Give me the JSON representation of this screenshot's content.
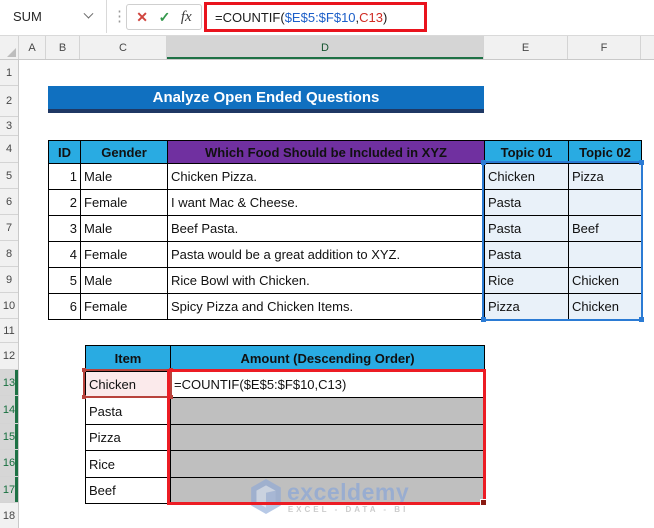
{
  "formula_bar": {
    "name_box_value": "SUM",
    "cancel_icon": "✕",
    "enter_icon": "✓",
    "fx_label": "fx",
    "formula_prefix": "=COUNTIF(",
    "formula_range": "$E$5:$F$10",
    "formula_sep": ",",
    "formula_ref": "C13",
    "formula_close": ")"
  },
  "grid": {
    "column_letters": [
      "A",
      "B",
      "C",
      "D",
      "E",
      "F"
    ],
    "selected_column": "D",
    "row_numbers": [
      "1",
      "2",
      "3",
      "4",
      "5",
      "6",
      "7",
      "8",
      "9",
      "10",
      "11",
      "12",
      "13",
      "14",
      "15",
      "16",
      "17",
      "18"
    ],
    "selected_rows": [
      13,
      14,
      15,
      16,
      17
    ]
  },
  "title_banner": {
    "text": "Analyze Open Ended Questions"
  },
  "survey_table": {
    "headers": {
      "id": "ID",
      "gender": "Gender",
      "question": "Which Food Should be Included in XYZ",
      "topic1": "Topic 01",
      "topic2": "Topic 02"
    },
    "rows": [
      {
        "id": "1",
        "gender": "Male",
        "question": "Chicken Pizza.",
        "topic1": "Chicken",
        "topic2": "Pizza"
      },
      {
        "id": "2",
        "gender": "Female",
        "question": "I want Mac & Cheese.",
        "topic1": "Pasta",
        "topic2": ""
      },
      {
        "id": "3",
        "gender": "Male",
        "question": "Beef Pasta.",
        "topic1": "Pasta",
        "topic2": "Beef"
      },
      {
        "id": "4",
        "gender": "Female",
        "question": "Pasta would be a great addition to XYZ.",
        "topic1": "Pasta",
        "topic2": ""
      },
      {
        "id": "5",
        "gender": "Male",
        "question": "Rice Bowl with Chicken.",
        "topic1": "Rice",
        "topic2": "Chicken"
      },
      {
        "id": "6",
        "gender": "Female",
        "question": "Spicy Pizza and Chicken Items.",
        "topic1": "Pizza",
        "topic2": "Chicken"
      }
    ]
  },
  "result_table": {
    "headers": {
      "item": "Item",
      "amount": "Amount (Descending Order)"
    },
    "items": [
      "Chicken",
      "Pasta",
      "Pizza",
      "Rice",
      "Beef"
    ],
    "formula_cell": "=COUNTIF($E$5:$F$10,C13)"
  },
  "watermark": {
    "brand": "exceldemy",
    "tagline": "EXCEL - DATA - BI"
  },
  "colors": {
    "banner_blue": "#1070c0",
    "banner_border": "#1f3864",
    "header_blue": "#29abe2",
    "header_purple": "#7030a0",
    "range_ref_blue": "#2b7bd4",
    "range_ref_fill": "#e9f1f9",
    "cell_ref_red": "#b8433c",
    "cell_ref_fill": "#fbeaeb",
    "annotation_red": "#ec1c24",
    "pending_gray": "#bfbfbf",
    "selected_header_green": "#1e7145"
  }
}
